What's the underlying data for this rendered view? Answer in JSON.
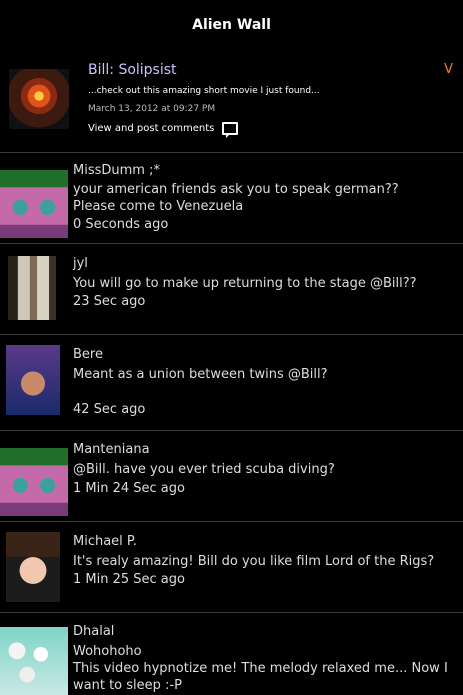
{
  "header": {
    "title": "Alien Wall"
  },
  "post": {
    "author": "Bill: Solipsist",
    "toggle": "V",
    "snippet": "...check out this amazing short movie I just found...",
    "date": "March 13, 2012 at 09:27 PM",
    "comments_label": "View and post comments"
  },
  "comments": [
    {
      "name": "MissDumm ;*",
      "text": "your american friends ask you to speak german??\nPlease come to Venezuela",
      "time": "0 Seconds ago"
    },
    {
      "name": "jyl",
      "text": "You will go to make up returning to the stage @Bill??",
      "time": "23 Sec ago"
    },
    {
      "name": "Bere",
      "text": "Meant as a union between twins @Bill?",
      "time": "42 Sec ago"
    },
    {
      "name": "Manteniana",
      "text": "@Bill. have you ever tried scuba diving?",
      "time": "1 Min 24 Sec ago"
    },
    {
      "name": "Michael P.",
      "text": "It's realy amazing! Bill do you like film Lord of the Rigs?",
      "time": "1 Min 25 Sec ago"
    },
    {
      "name": "Dhalal",
      "text": "Wohohoho\nThis video hypnotize me! The melody relaxed me... Now I want to sleep :-P",
      "time": ""
    }
  ]
}
